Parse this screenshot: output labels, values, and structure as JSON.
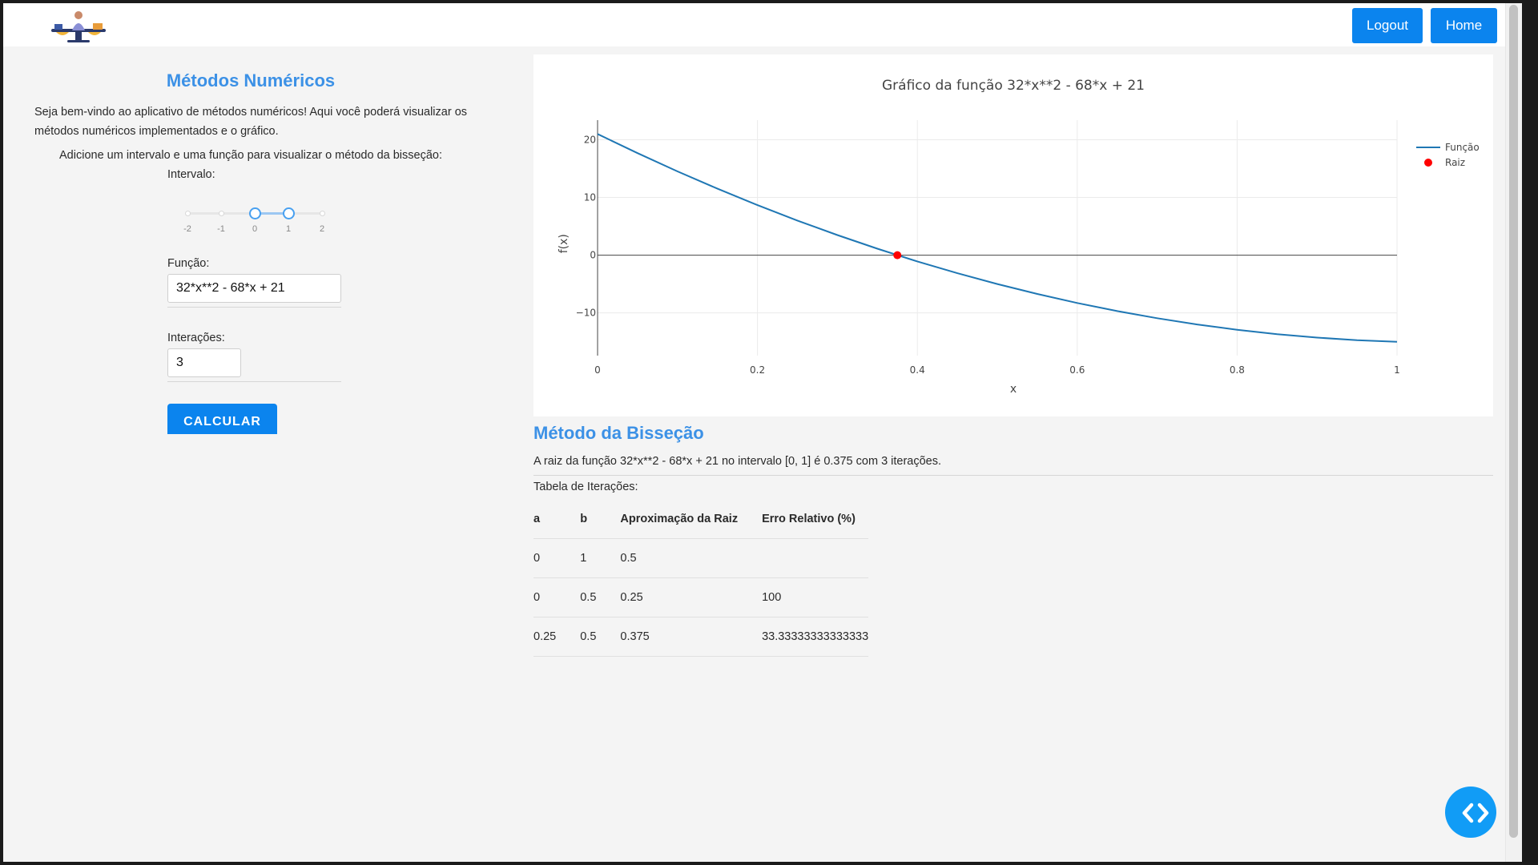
{
  "navbar": {
    "logout_label": "Logout",
    "home_label": "Home"
  },
  "sidebar": {
    "title": "Métodos Numéricos",
    "welcome": "Seja bem-vindo ao aplicativo de métodos numéricos! Aqui você poderá visualizar os métodos numéricos implementados e o gráfico.",
    "hint": "Adicione um intervalo e uma função para visualizar o método da bisseção:",
    "interval_label": "Intervalo:",
    "slider": {
      "marks": [
        "-2",
        "-1",
        "0",
        "1",
        "2"
      ],
      "min": -2,
      "max": 2,
      "value": [
        0,
        1
      ]
    },
    "function_label": "Função:",
    "function_value": "32*x**2 - 68*x + 21",
    "iterations_label": "Interações:",
    "iterations_value": "3",
    "calculate_label": "CALCULAR"
  },
  "chart_data": {
    "type": "line",
    "title": "Gráfico da função 32*x**2 - 68*x + 21",
    "xlabel": "x",
    "ylabel": "f(x)",
    "xlim": [
      0,
      1
    ],
    "ylim": [
      -17.4,
      23.4
    ],
    "xticks": [
      0,
      0.2,
      0.4,
      0.6,
      0.8,
      1
    ],
    "xtick_labels": [
      "0",
      "0.2",
      "0.4",
      "0.6",
      "0.8",
      "1"
    ],
    "yticks": [
      -10,
      0,
      10,
      20
    ],
    "ytick_labels": [
      "−10",
      "0",
      "10",
      "20"
    ],
    "grid": true,
    "legend": "top-right",
    "series": [
      {
        "name": "Função",
        "type": "line",
        "color": "#1f77b4",
        "x": [
          0,
          0.05,
          0.1,
          0.15,
          0.2,
          0.25,
          0.3,
          0.35,
          0.4,
          0.45,
          0.5,
          0.55,
          0.6,
          0.65,
          0.7,
          0.75,
          0.8,
          0.85,
          0.9,
          0.95,
          1
        ],
        "y": [
          21,
          17.68,
          14.52,
          11.52,
          8.68,
          6,
          3.48,
          1.12,
          -1.08,
          -3.12,
          -5,
          -6.72,
          -8.28,
          -9.68,
          -10.92,
          -12,
          -12.92,
          -13.68,
          -14.28,
          -14.72,
          -15
        ]
      },
      {
        "name": "Raiz",
        "type": "scatter",
        "color": "#ff0000",
        "x": [
          0.375
        ],
        "y": [
          0
        ]
      }
    ]
  },
  "result": {
    "title": "Método da Bisseção",
    "text": "A raiz da função 32*x**2 - 68*x + 21 no intervalo [0, 1] é 0.375 com 3 iterações.",
    "table_label": "Tabela de Iterações:",
    "columns": [
      "a",
      "b",
      "Aproximação da Raiz",
      "Erro Relativo (%)"
    ],
    "rows": [
      [
        "0",
        "1",
        "0.5",
        ""
      ],
      [
        "0",
        "0.5",
        "0.25",
        "100"
      ],
      [
        "0.25",
        "0.5",
        "0.375",
        "33.33333333333333"
      ]
    ]
  },
  "icons": {
    "logo": "balance-scale-logo-icon",
    "fab": "code-brackets-icon"
  }
}
